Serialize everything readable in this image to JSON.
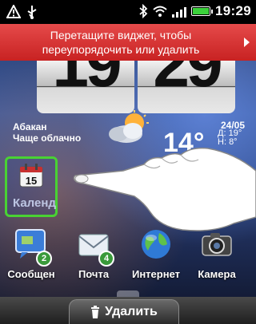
{
  "status_bar": {
    "time": "19:29",
    "icons": [
      "usb-warning-icon",
      "usb-icon",
      "bluetooth-icon",
      "wifi-icon",
      "signal-icon",
      "battery-icon"
    ]
  },
  "hint": {
    "text_line1": "Перетащите виджет, чтобы",
    "text_line2": "переупорядочить или удалить"
  },
  "clock": {
    "hour": "19",
    "minute": "29"
  },
  "weather": {
    "city": "Абакан",
    "condition": "Чаще облачно",
    "temperature": "14°",
    "date": "24/05",
    "low_label": "Д:",
    "low": "19°",
    "high_label": "Н:",
    "high": "8°",
    "icon": "cloud-sun-icon"
  },
  "dragged_widget": {
    "label": "Календ",
    "icon": "calendar-icon",
    "date_number": "15",
    "highlight_color": "#49d233"
  },
  "dock": [
    {
      "label": "Сообщен",
      "icon": "messages-icon",
      "badge": "2"
    },
    {
      "label": "Почта",
      "icon": "mail-icon",
      "badge": "4"
    },
    {
      "label": "Интернет",
      "icon": "globe-icon",
      "badge": ""
    },
    {
      "label": "Камера",
      "icon": "camera-icon",
      "badge": ""
    }
  ],
  "bottom": {
    "delete_label": "Удалить",
    "delete_icon": "trash-icon"
  },
  "colors": {
    "banner_red": "#c82222",
    "battery_green": "#3bd13b",
    "badge_green": "#3a9a3a"
  }
}
